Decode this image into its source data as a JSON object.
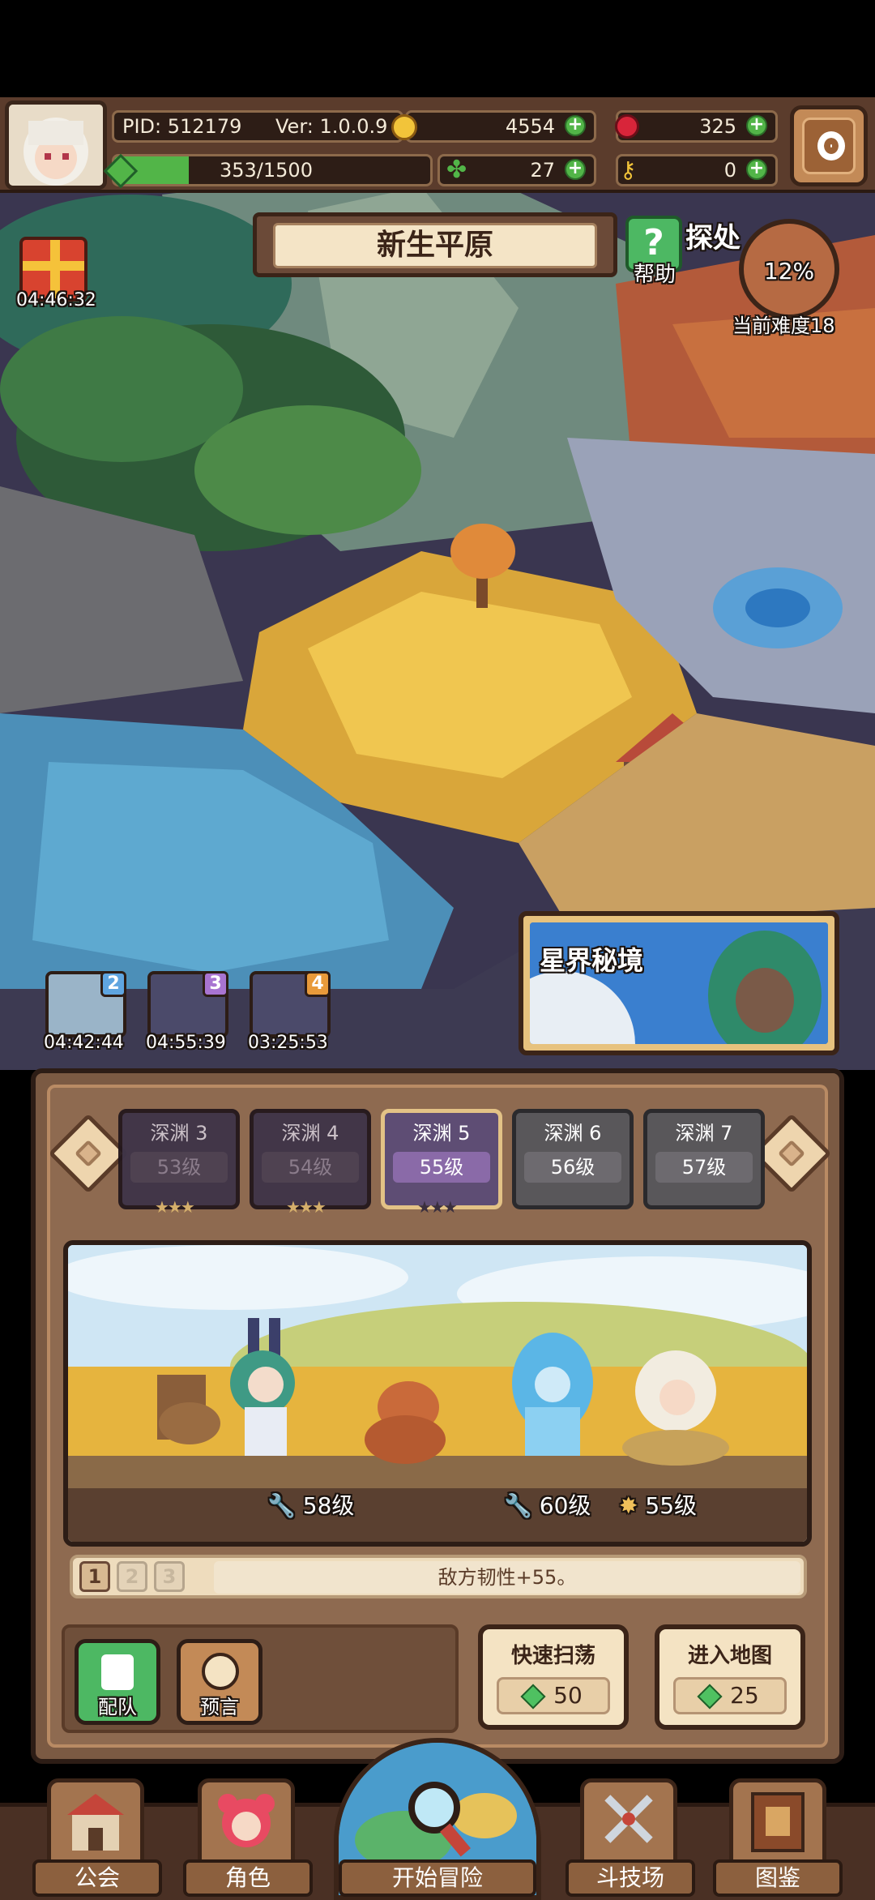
{
  "player": {
    "pid": "PID: 512179",
    "version": "Ver: 1.0.0.9",
    "exp": "353/1500",
    "exp_fraction": 0.235
  },
  "currencies": {
    "gold": "4554",
    "gem": "325",
    "clover": "27",
    "key": "0"
  },
  "area": {
    "name": "新生平原",
    "help_label": "帮助",
    "explore_partial": "探处",
    "difficulty_pct": "12%",
    "difficulty_label": "当前难度18"
  },
  "gift": {
    "timer": "04:46:32"
  },
  "chests": [
    {
      "num": "2",
      "timer": "04:42:44",
      "color": "#5fa5e0"
    },
    {
      "num": "3",
      "timer": "04:55:39",
      "color": "#a874d1"
    },
    {
      "num": "4",
      "timer": "03:25:53",
      "color": "#e89a3a"
    }
  ],
  "star_realm": {
    "label": "星界秘境"
  },
  "stages": [
    {
      "name": "深渊 3",
      "level": "53级",
      "stars": "★★★"
    },
    {
      "name": "深渊 4",
      "level": "54级",
      "stars": "★★★"
    },
    {
      "name": "深渊 5",
      "level": "55级",
      "stars": "★★★"
    },
    {
      "name": "深渊 6",
      "level": "56级"
    },
    {
      "name": "深渊 7",
      "level": "57级"
    }
  ],
  "enemy_levels": [
    "58级",
    "60级",
    "55级"
  ],
  "pages": [
    "1",
    "2",
    "3"
  ],
  "tip": "敌方韧性+55。",
  "actions": {
    "team": "配队",
    "prophecy": "预言",
    "sweep": {
      "label": "快速扫荡",
      "cost": "50"
    },
    "enter": {
      "label": "进入地图",
      "cost": "25"
    }
  },
  "nav": {
    "guild": "公会",
    "character": "角色",
    "start": "开始冒险",
    "arena": "斗技场",
    "codex": "图鉴"
  }
}
